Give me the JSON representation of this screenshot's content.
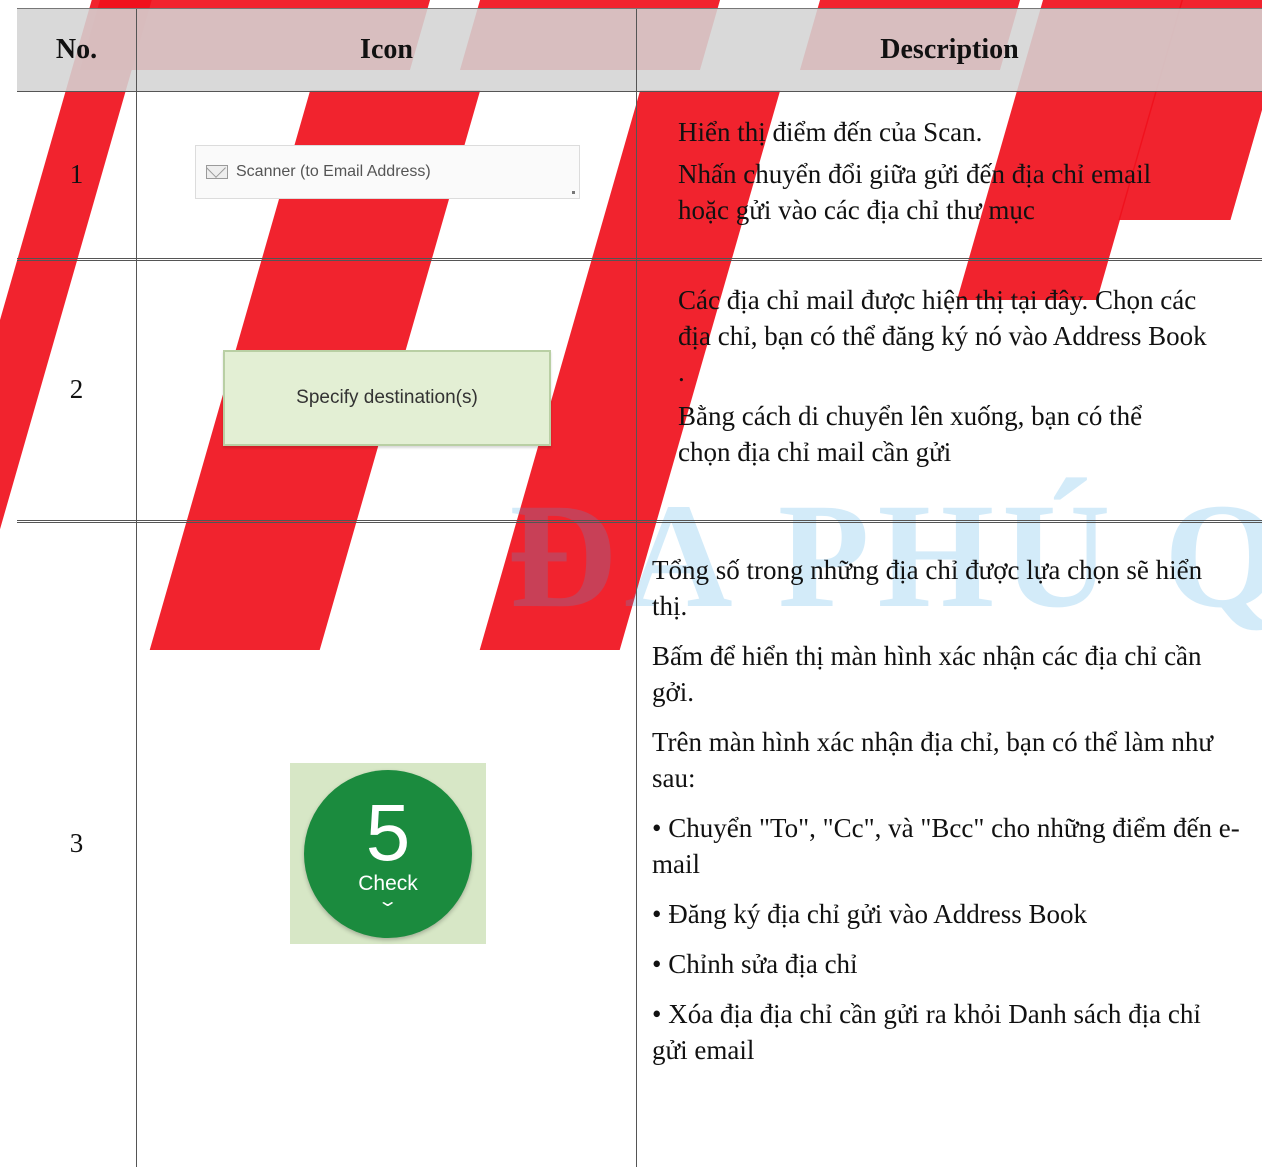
{
  "table": {
    "headers": {
      "no": "No.",
      "icon": "Icon",
      "description": "Description"
    },
    "rows": [
      {
        "no": "1",
        "icon": {
          "type": "field",
          "label": "Scanner (to Email Address)",
          "icon": "mail-icon"
        },
        "description": [
          "Hiển thị điểm đến của Scan.",
          "Nhấn chuyển đổi giữa gửi đến địa chỉ email hoặc gửi vào các địa chỉ thư mục"
        ]
      },
      {
        "no": "2",
        "icon": {
          "type": "button",
          "label": "Specify destination(s)"
        },
        "description": [
          "Các địa chỉ mail được hiện thị tại đây. Chọn các địa chỉ, bạn có thể đăng ký nó vào Address Book .",
          "Bằng cách di chuyển lên xuống, bạn có thể chọn địa chỉ mail cần gửi"
        ]
      },
      {
        "no": "3",
        "icon": {
          "type": "badge",
          "count": "5",
          "label": "Check",
          "icon": "chevron-down-icon"
        },
        "description": [
          "Tổng số trong những địa chỉ được lựa chọn sẽ hiển thị.",
          "Bấm để hiển thị màn hình xác nhận các địa chỉ cần gởi.",
          "Trên màn hình xác nhận địa chỉ, bạn có thể làm như sau:",
          "• Chuyển \"To\", \"Cc\", và \"Bcc\" cho những điểm đến e-mail",
          "• Đăng ký địa chỉ gửi vào Address Book",
          "• Chỉnh sửa địa chỉ",
          "• Xóa địa địa chỉ cần gửi ra khỏi Danh sách địa chỉ gửi email"
        ]
      }
    ]
  },
  "watermark": {
    "text": "ĐA PHÚ QU",
    "colors": {
      "red": "#f0101c",
      "blue": "#3aa7e8"
    }
  }
}
